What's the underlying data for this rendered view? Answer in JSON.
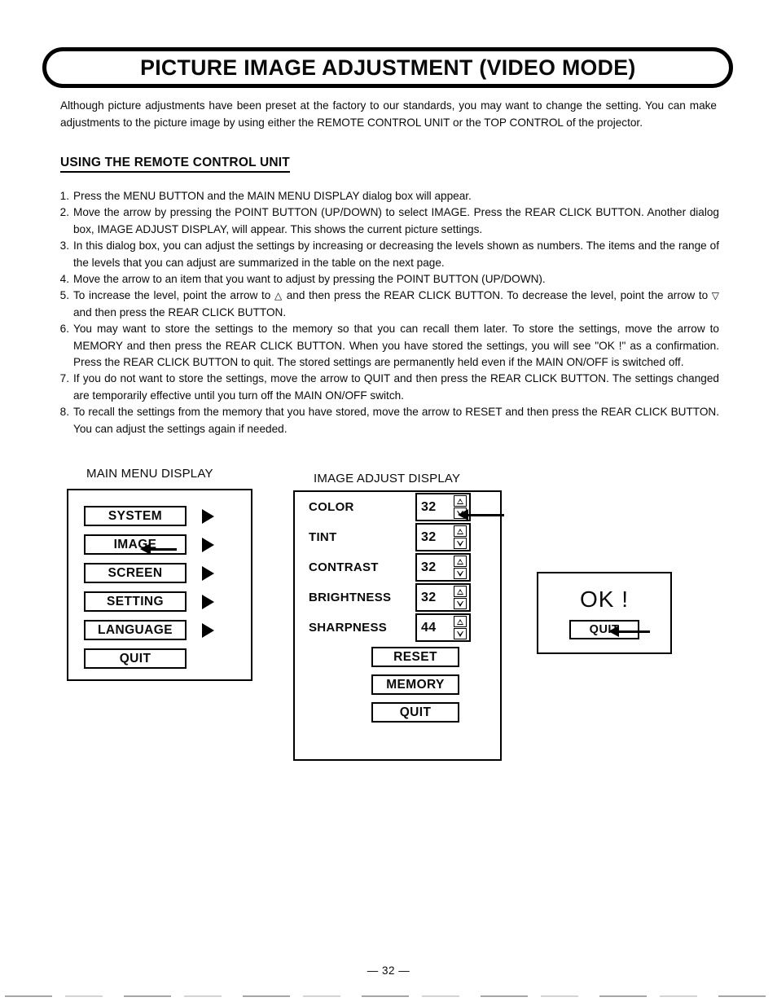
{
  "document": {
    "title": "PICTURE IMAGE ADJUSTMENT (VIDEO MODE)",
    "page_number": "— 32 —"
  },
  "intro": {
    "paragraph": "Although picture adjustments have been preset at the factory to our standards, you may want to change the setting. You can make adjustments to the picture image by using either the REMOTE CONTROL UNIT or the TOP CONTROL of the projector."
  },
  "section": {
    "heading": "USING THE REMOTE CONTROL UNIT"
  },
  "steps": [
    {
      "num": "1.",
      "text": "Press the MENU BUTTON and the MAIN MENU DISPLAY dialog box will appear."
    },
    {
      "num": "2.",
      "text": "Move the arrow by pressing the POINT BUTTON (UP/DOWN) to select IMAGE. Press the REAR CLICK BUTTON. Another dialog box, IMAGE ADJUST DISPLAY, will appear. This shows the current picture settings."
    },
    {
      "num": "3.",
      "text": "In this dialog box, you can adjust the settings by increasing or decreasing the levels shown as numbers. The items and the range of the levels that you can adjust are summarized in the table on the next page."
    },
    {
      "num": "4.",
      "text": "Move the arrow to an item that you want to adjust by pressing the POINT BUTTON (UP/DOWN)."
    },
    {
      "num": "5.",
      "text_part1": "To increase the level, point the arrow to ",
      "glyph_up": "△",
      "text_part2": " and then press the REAR CLICK BUTTON. To decrease the level, point the arrow to ",
      "glyph_down": "▽",
      "text_part3": " and then press the REAR CLICK BUTTON."
    },
    {
      "num": "6.",
      "text": "You may want to store the settings to the memory so that you can recall them later. To store the settings, move the arrow to MEMORY and then press the REAR CLICK BUTTON. When you have stored the settings, you will see \"OK !\" as a confirmation. Press the REAR CLICK BUTTON to quit. The stored settings are permanently held even if the MAIN ON/OFF is switched off."
    },
    {
      "num": "7.",
      "text": "If you do not want to store the settings, move the arrow to QUIT and then press the REAR CLICK BUTTON. The settings changed are temporarily effective until you turn off the MAIN ON/OFF switch."
    },
    {
      "num": "8.",
      "text": "To recall the settings from the memory that you have stored, move the arrow to RESET and then press the REAR CLICK BUTTON. You can adjust the settings again if needed."
    }
  ],
  "main_menu": {
    "caption": "MAIN MENU DISPLAY",
    "items": [
      {
        "label": "SYSTEM",
        "has_arrow": true,
        "selected": false
      },
      {
        "label": "IMAGE",
        "has_arrow": true,
        "selected": true
      },
      {
        "label": "SCREEN",
        "has_arrow": true,
        "selected": false
      },
      {
        "label": "SETTING",
        "has_arrow": true,
        "selected": false
      },
      {
        "label": "LANGUAGE",
        "has_arrow": true,
        "selected": false
      },
      {
        "label": "QUIT",
        "has_arrow": false,
        "selected": false
      }
    ]
  },
  "image_adjust": {
    "caption": "IMAGE ADJUST DISPLAY",
    "rows": [
      {
        "label": "COLOR",
        "value": "32",
        "pointed": true
      },
      {
        "label": "TINT",
        "value": "32",
        "pointed": false
      },
      {
        "label": "CONTRAST",
        "value": "32",
        "pointed": false
      },
      {
        "label": "BRIGHTNESS",
        "value": "32",
        "pointed": false
      },
      {
        "label": "SHARPNESS",
        "value": "44",
        "pointed": false
      }
    ],
    "actions": [
      {
        "label": "RESET"
      },
      {
        "label": "MEMORY"
      },
      {
        "label": "QUIT"
      }
    ]
  },
  "ok_dialog": {
    "message": "OK !",
    "quit_label": "QUIT"
  }
}
